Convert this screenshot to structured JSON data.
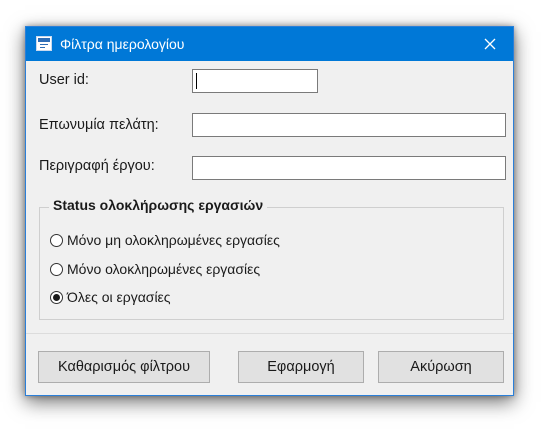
{
  "dialog": {
    "title": "Φίλτρα ημερολογίου",
    "icon": "calendar-window-icon",
    "close_icon": "close-icon"
  },
  "fields": [
    {
      "label": "User id:",
      "value": "",
      "placeholder": ""
    },
    {
      "label": "Επωνυμία πελάτη:",
      "value": "",
      "placeholder": ""
    },
    {
      "label": "Περιγραφή έργου:",
      "value": "",
      "placeholder": ""
    }
  ],
  "status_group": {
    "title": "Status ολοκλήρωσης εργασιών",
    "options": [
      {
        "label": "Μόνο μη ολοκληρωμένες εργασίες",
        "checked": false
      },
      {
        "label": "Μόνο ολοκληρωμένες εργασίες",
        "checked": false
      },
      {
        "label": "Όλες οι εργασίες",
        "checked": true
      }
    ]
  },
  "buttons": {
    "clear_label": "Καθαρισμός φίλτρου",
    "apply_label": "Εφαρμογή",
    "cancel_label": "Ακύρωση"
  },
  "colors": {
    "titlebar": "#0078d7",
    "window_bg": "#f0f0f0",
    "button_bg": "#e1e1e1"
  }
}
